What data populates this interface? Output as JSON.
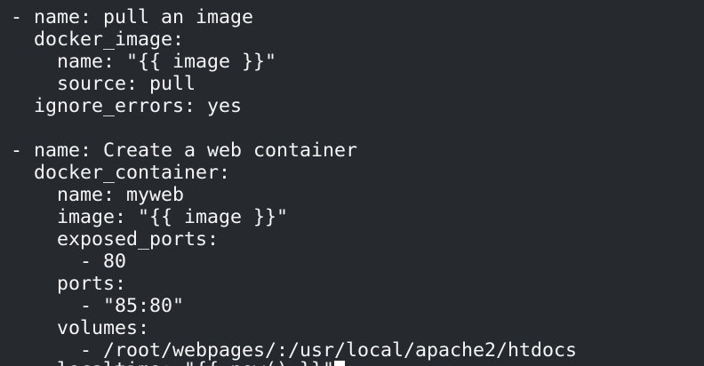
{
  "terminal": {
    "lines": [
      "- name: pull an image",
      "  docker_image:",
      "    name: \"{{ image }}\"",
      "    source: pull",
      "  ignore_errors: yes",
      "",
      "- name: Create a web container",
      "  docker_container:",
      "    name: myweb",
      "    image: \"{{ image }}\"",
      "    exposed_ports:",
      "      - 80",
      "    ports:",
      "      - \"85:80\"",
      "    volumes:",
      "      - /root/webpages/:/usr/local/apache2/htdocs",
      "    localtime: \"{{ now() }}\""
    ]
  },
  "colors": {
    "background": "#262a2f",
    "text": "#f5f5f5",
    "cursor": "#ffffff"
  }
}
